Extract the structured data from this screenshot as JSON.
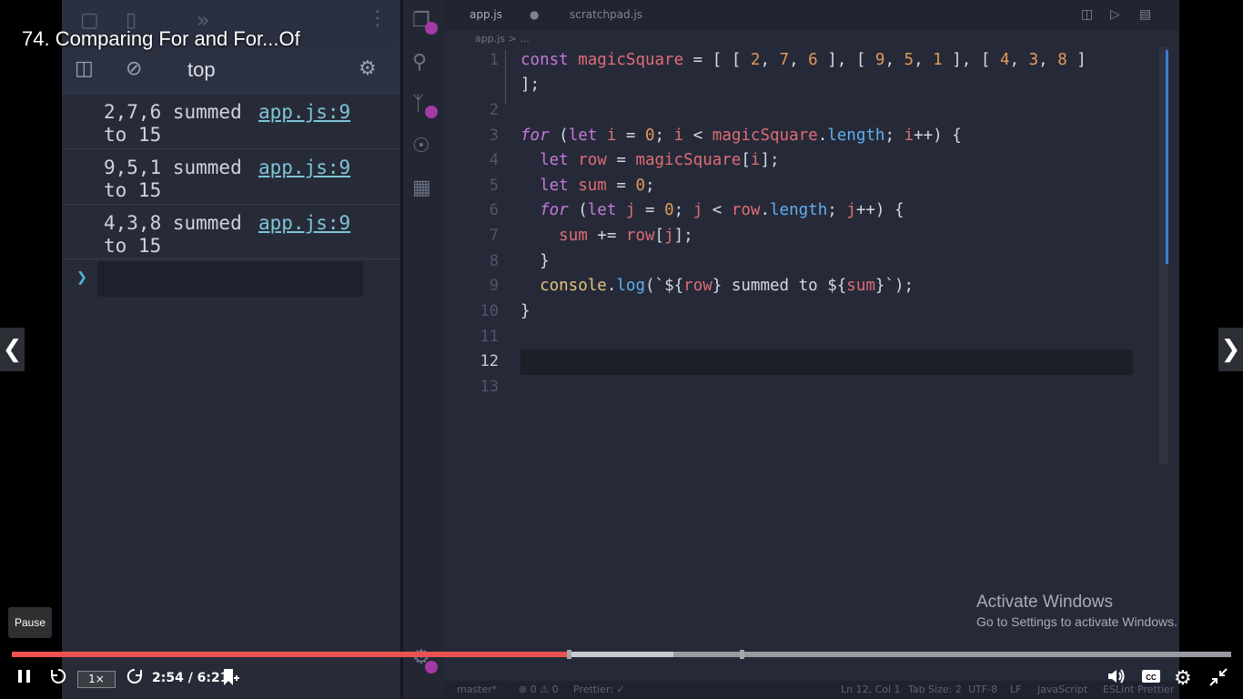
{
  "video": {
    "title": "74. Comparing For and For...Of",
    "tooltip": "Pause",
    "time": "2:54 / 6:21",
    "speed": "1×",
    "progress_fraction": 0.4568,
    "buffer_fraction": 0.5425,
    "colors": {
      "progress": "#ec5252",
      "accent": "#ffffff"
    }
  },
  "devtools": {
    "context": "top",
    "console": [
      {
        "message": "2,7,6 summed\nto 15",
        "source": "app.js:9"
      },
      {
        "message": "9,5,1 summed\nto 15",
        "source": "app.js:9"
      },
      {
        "message": "4,3,8 summed\nto 15",
        "source": "app.js:9"
      }
    ]
  },
  "editor": {
    "tabs": [
      "app.js",
      "scratchpad.js"
    ],
    "breadcrumb": "app.js > ...",
    "line_numbers": [
      "1",
      "2",
      "3",
      "4",
      "5",
      "6",
      "7",
      "8",
      "9",
      "10",
      "11",
      "12",
      "13"
    ],
    "active_line": "12",
    "lines": [
      "const magicSquare = [ [ 2, 7, 6 ], [ 9, 5, 1 ], [ 4, 3, 8 ]",
      "];",
      "",
      "for (let i = 0; i < magicSquare.length; i++) {",
      "  let row = magicSquare[i];",
      "  let sum = 0;",
      "  for (let j = 0; j < row.length; j++) {",
      "    sum += row[j];",
      "  }",
      "  console.log(`${row} summed to ${sum}`);",
      "}",
      "",
      ""
    ],
    "statusbar": {
      "branch": "master*",
      "problems": "⊗ 0 ⚠ 0",
      "prettier": "Prettier: ✓",
      "cursor": "Ln 12, Col 1",
      "tab_size": "Tab Size: 2",
      "encoding": "UTF-8",
      "eol": "LF",
      "language": "JavaScript",
      "eslint": "ESLint",
      "prettier_right": "Prettier"
    }
  },
  "watermark": {
    "line1": "Activate Windows",
    "line2": "Go to Settings to activate Windows."
  },
  "icons": [
    "pause-icon",
    "rewind-icon",
    "forward-icon",
    "bookmark-icon",
    "volume-icon",
    "captions-icon",
    "settings-icon",
    "exit-fullscreen-icon",
    "chevron-left-icon",
    "chevron-right-icon"
  ]
}
